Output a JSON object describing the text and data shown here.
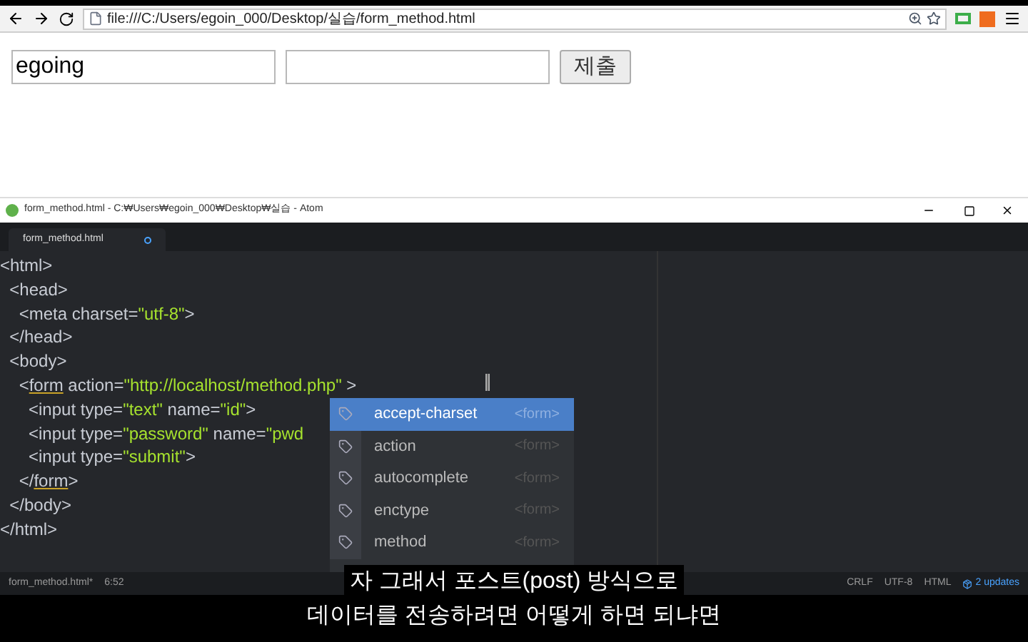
{
  "browser": {
    "url": "file:///C:/Users/egoin_000/Desktop/실습/form_method.html"
  },
  "page": {
    "fields": [
      {
        "kind": "text",
        "value": "egoing"
      },
      {
        "kind": "password"
      }
    ],
    "submit": "제출"
  },
  "atom": {
    "title": "form_method.html - C:₩Users₩egoin_000₩Desktop₩실습 - Atom",
    "tabs": [
      {
        "label": "form_method.html",
        "selected": true,
        "modified": true
      }
    ],
    "code": [
      [
        {
          "kind": "code",
          "text": "<html>"
        }
      ],
      [
        {
          "kind": "code",
          "text": "  <head>"
        }
      ],
      [
        {
          "kind": "code",
          "text": "    <meta charset="
        },
        {
          "kind": "string",
          "text": "\"utf-8\""
        },
        {
          "kind": "code",
          "text": ">"
        }
      ],
      [
        {
          "kind": "code",
          "text": "  </head>"
        }
      ],
      [
        {
          "kind": "code",
          "text": "  <body>"
        }
      ],
      [
        {
          "kind": "code",
          "text": "    <"
        },
        {
          "kind": "matched",
          "text": "form"
        },
        {
          "kind": "code",
          "text": " action="
        },
        {
          "kind": "string",
          "text": "\"http://localhost/method.php\""
        },
        {
          "kind": "code",
          "text": " >"
        }
      ],
      [
        {
          "kind": "code",
          "text": "      <input type="
        },
        {
          "kind": "string",
          "text": "\"text\""
        },
        {
          "kind": "code",
          "text": " name="
        },
        {
          "kind": "string",
          "text": "\"id\""
        },
        {
          "kind": "code",
          "text": ">"
        }
      ],
      [
        {
          "kind": "code",
          "text": "      <input type="
        },
        {
          "kind": "string",
          "text": "\"password\""
        },
        {
          "kind": "code",
          "text": " name="
        },
        {
          "kind": "string",
          "text": "\"pwd"
        }
      ],
      [
        {
          "kind": "code",
          "text": "      <input type="
        },
        {
          "kind": "string",
          "text": "\"submit\""
        },
        {
          "kind": "code",
          "text": ">"
        }
      ],
      [
        {
          "kind": "code",
          "text": "    </"
        },
        {
          "kind": "matched",
          "text": "form"
        },
        {
          "kind": "code",
          "text": ">"
        }
      ],
      [
        {
          "kind": "code",
          "text": "  </body>"
        }
      ],
      [
        {
          "kind": "code",
          "text": "</html>"
        }
      ]
    ],
    "suggestions": [
      {
        "text": "accept-charset",
        "scope": "<form>",
        "selected": true
      },
      {
        "text": "action",
        "scope": "<form>",
        "selected": false
      },
      {
        "text": "autocomplete",
        "scope": "<form>",
        "selected": false
      },
      {
        "text": "enctype",
        "scope": "<form>",
        "selected": false
      },
      {
        "text": "method",
        "scope": "<form>",
        "selected": false
      }
    ],
    "status": {
      "file": "form_method.html*",
      "position": "6:52",
      "items": [
        "CRLF",
        "UTF-8",
        "HTML"
      ],
      "updates": "2 updates"
    }
  },
  "subtitles": [
    "자 그래서 포스트(post) 방식으로",
    "데이터를 전송하려면 어떻게 하면 되냐면"
  ]
}
